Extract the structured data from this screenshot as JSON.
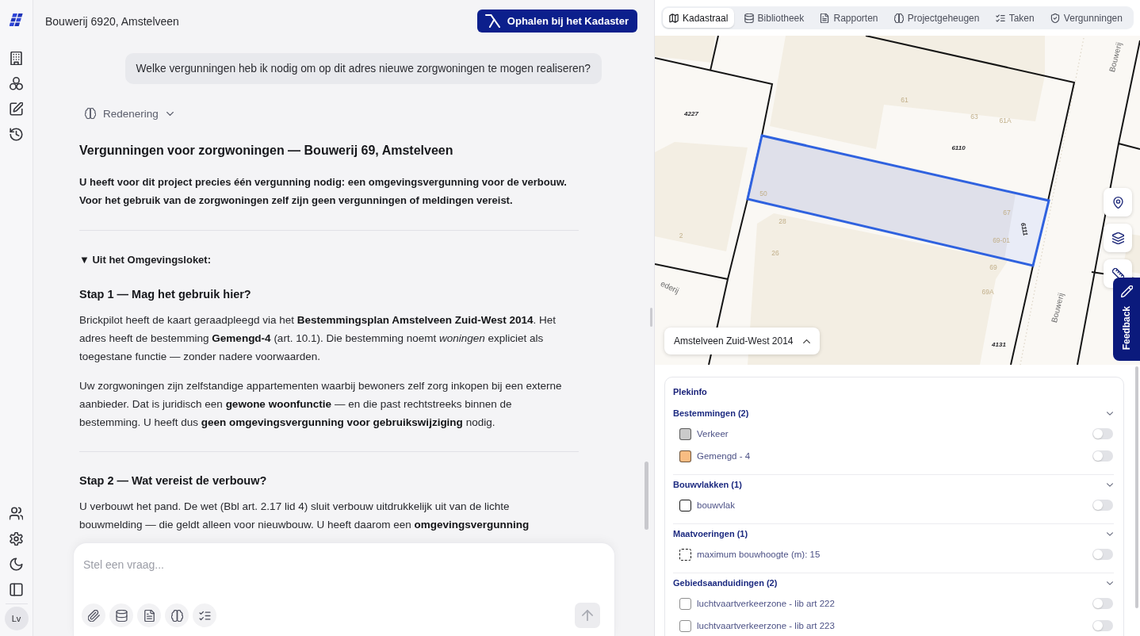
{
  "header": {
    "title": "Bouwerij 6920, Amstelveen",
    "action_button": "Ophalen bij het Kadaster"
  },
  "chat": {
    "user_message": "Welke vergunningen heb ik nodig om op dit adres nieuwe zorgwoningen te mogen realiseren?",
    "reasoning_toggle": "Redenering",
    "answer": {
      "title": "Vergunningen voor zorgwoningen — Bouwerij 69, Amstelveen",
      "intro": "U heeft voor dit project precies één vergunning nodig: een omgevingsvergunning voor de verbouw. Voor het gebruik van de zorgwoningen zelf zijn geen vergunningen of meldingen vereist.",
      "source_summary": "▼ Uit het Omgevingsloket:",
      "steps": [
        {
          "title": "Stap 1 — Mag het gebruik hier?",
          "paragraphs": [
            "Brickpilot heeft de kaart geraadpleegd via het **Bestemmingsplan Amstelveen Zuid-West 2014**. Het adres heeft de bestemming **Gemengd-4** (art. 10.1). Die bestemming noemt *woningen* expliciet als toegestane functie — zonder nadere voorwaarden.",
            "Uw zorgwoningen zijn zelfstandige appartementen waarbij bewoners zelf zorg inkopen bij een externe aanbieder. Dat is juridisch een **gewone woonfunctie** — en die past rechtstreeks binnen de bestemming. U heeft dus **geen omgevingsvergunning voor gebruikswijziging** nodig."
          ]
        },
        {
          "title": "Stap 2 — Wat vereist de verbouw?",
          "paragraphs": [
            "U verbouwt het pand. De wet (Bbl art. 2.17 lid 4) sluit verbouw uitdrukkelijk uit van de lichte bouwmelding — die geldt alleen voor nieuwbouw. U heeft daarom een **omgevingsvergunning**"
          ]
        }
      ]
    }
  },
  "composer": {
    "placeholder": "Stel een vraag..."
  },
  "account": {
    "initials": "Lv"
  },
  "panel_tabs": [
    {
      "label": "Kadastraal",
      "selected": true
    },
    {
      "label": "Bibliotheek",
      "selected": false
    },
    {
      "label": "Rapporten",
      "selected": false
    },
    {
      "label": "Projectgeheugen",
      "selected": false
    },
    {
      "label": "Taken",
      "selected": false
    },
    {
      "label": "Vergunningen",
      "selected": false
    }
  ],
  "map": {
    "labels": [
      {
        "text": "Bouwerij",
        "kind": "street"
      },
      {
        "text": "61",
        "kind": "house"
      },
      {
        "text": "4227",
        "kind": "parcel"
      },
      {
        "text": "63",
        "kind": "house"
      },
      {
        "text": "61A",
        "kind": "house"
      },
      {
        "text": "6110",
        "kind": "parcel"
      },
      {
        "text": "50",
        "kind": "house"
      },
      {
        "text": "67",
        "kind": "house"
      },
      {
        "text": "28",
        "kind": "house"
      },
      {
        "text": "6111",
        "kind": "parcel"
      },
      {
        "text": "2",
        "kind": "house"
      },
      {
        "text": "69-01",
        "kind": "house"
      },
      {
        "text": "26",
        "kind": "house"
      },
      {
        "text": "69",
        "kind": "house"
      },
      {
        "text": "ederij",
        "kind": "street"
      },
      {
        "text": "69A",
        "kind": "house"
      },
      {
        "text": "Bouwerij",
        "kind": "street"
      },
      {
        "text": "4131",
        "kind": "parcel"
      }
    ],
    "plan_selector": "Amstelveen Zuid-West 2014",
    "feedback_tab": "Feedback"
  },
  "plekinfo": {
    "title": "Plekinfo",
    "sections": [
      {
        "title": "Bestemmingen (2)",
        "items": [
          {
            "label": "Verkeer",
            "kind": "fill",
            "color": "#cacaca",
            "on": false
          },
          {
            "label": "Gemengd - 4",
            "kind": "fill",
            "color": "#f8bc82",
            "on": false
          }
        ]
      },
      {
        "title": "Bouwvlakken (1)",
        "items": [
          {
            "label": "bouwvlak",
            "kind": "outline",
            "color": "#1a1a1a",
            "on": false
          }
        ]
      },
      {
        "title": "Maatvoeringen (1)",
        "items": [
          {
            "label": "maximum bouwhoogte (m): 15",
            "kind": "dashed",
            "color": "#1a1a1a",
            "on": false
          }
        ]
      },
      {
        "title": "Gebiedsaanduidingen (2)",
        "items": [
          {
            "label": "luchtvaartverkeerzone - lib art 222",
            "kind": "outline",
            "color": "#8e8e8e",
            "on": false
          },
          {
            "label": "luchtvaartverkeerzone - lib art 223",
            "kind": "outline",
            "color": "#8e8e8e",
            "on": false
          }
        ]
      }
    ]
  }
}
